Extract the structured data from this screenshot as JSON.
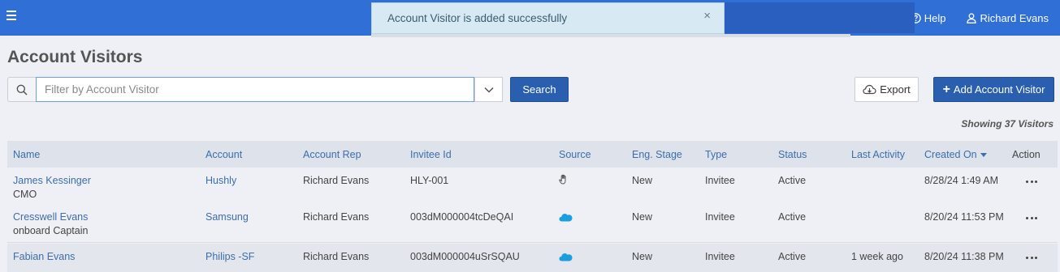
{
  "header": {
    "menu_icon": "hamburger-icon",
    "help_label": "Help",
    "help_icon": "question-circle-icon",
    "user_name": "Richard Evans",
    "user_icon": "user-icon",
    "bar_color": "#2f6fd6"
  },
  "toast": {
    "message": "Account Visitor is added successfully",
    "close_symbol": "×"
  },
  "page": {
    "title": "Account Visitors"
  },
  "toolbar": {
    "search_placeholder": "Filter by Account Visitor",
    "search_value": "",
    "search_label": "Search",
    "export_label": "Export",
    "add_label": "Add Account Visitor",
    "add_symbol": "+"
  },
  "summary": {
    "showing": "Showing 37 Visitors"
  },
  "table": {
    "columns": [
      "Name",
      "Account",
      "Account Rep",
      "Invitee Id",
      "Source",
      "Eng. Stage",
      "Type",
      "Status",
      "Last Activity",
      "Created On",
      "Action"
    ],
    "rows": [
      {
        "name": "James Kessinger",
        "title": "CMO",
        "account": "Hushly",
        "rep": "Richard Evans",
        "invitee_id": "HLY-001",
        "source": "hand-pointer-icon",
        "stage": "New",
        "type": "Invitee",
        "status": "Active",
        "last_activity": "",
        "created_on": "8/28/24 1:49 AM"
      },
      {
        "name": "Cresswell Evans",
        "title": "onboard Captain",
        "account": "Samsung",
        "rep": "Richard Evans",
        "invitee_id": "003dM000004tcDeQAI",
        "source": "salesforce-cloud-icon",
        "stage": "New",
        "type": "Invitee",
        "status": "Active",
        "last_activity": "",
        "created_on": "8/20/24 11:53 PM"
      },
      {
        "name": "Fabian Evans",
        "title": "",
        "account": "Philips -SF",
        "rep": "Richard Evans",
        "invitee_id": "003dM000004uSrSQAU",
        "source": "salesforce-cloud-icon",
        "stage": "New",
        "type": "Invitee",
        "status": "Active",
        "last_activity": "1 week ago",
        "created_on": "8/20/24 11:38 PM"
      }
    ]
  },
  "colors": {
    "primary_button": "#2a5fb0",
    "link": "#3d6ea8",
    "salesforce": "#1a9ee0",
    "toast_bg": "#d7eaf3"
  }
}
